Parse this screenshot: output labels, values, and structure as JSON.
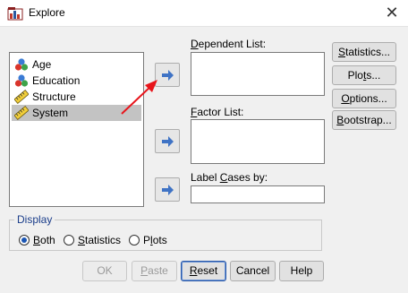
{
  "window": {
    "title": "Explore",
    "close_glyph": "✕"
  },
  "variables": [
    {
      "label": "Age",
      "icon": "nominal-variable-icon",
      "selected": false
    },
    {
      "label": "Education",
      "icon": "nominal-variable-icon",
      "selected": false
    },
    {
      "label": "Structure",
      "icon": "scale-variable-icon",
      "selected": false
    },
    {
      "label": "System",
      "icon": "scale-variable-icon",
      "selected": true
    }
  ],
  "fields": {
    "dependent": {
      "pre": "",
      "ul": "D",
      "post": "ependent List:"
    },
    "factor": {
      "pre": "",
      "ul": "F",
      "post": "actor List:"
    },
    "label_cases": {
      "pre": "Label ",
      "ul": "C",
      "post": "ases by:"
    }
  },
  "side_buttons": {
    "statistics": {
      "pre": "",
      "ul": "S",
      "post": "tatistics..."
    },
    "plots": {
      "pre": "Plo",
      "ul": "t",
      "post": "s..."
    },
    "options": {
      "pre": "",
      "ul": "O",
      "post": "ptions..."
    },
    "bootstrap": {
      "pre": "",
      "ul": "B",
      "post": "ootstrap..."
    }
  },
  "display": {
    "legend": "Display",
    "options": [
      {
        "pre": "",
        "ul": "B",
        "post": "oth",
        "checked": true
      },
      {
        "pre": "",
        "ul": "S",
        "post": "tatistics",
        "checked": false
      },
      {
        "pre": "P",
        "ul": "l",
        "post": "ots",
        "checked": false
      }
    ]
  },
  "bottom_buttons": {
    "ok": "OK",
    "paste": {
      "pre": "",
      "ul": "P",
      "post": "aste"
    },
    "reset": {
      "pre": "",
      "ul": "R",
      "post": "eset"
    },
    "cancel": "Cancel",
    "help": "Help"
  },
  "colors": {
    "accent": "#1a55b3",
    "arrow_button_glyph": "#3f73c5",
    "annotation_arrow": "#e8141b",
    "selected_row": "#c3c3c3"
  }
}
